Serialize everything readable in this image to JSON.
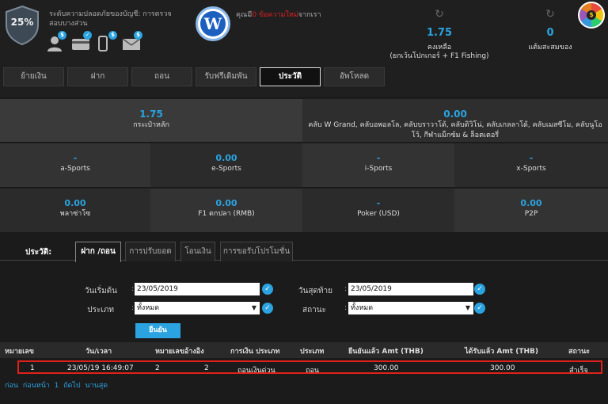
{
  "header": {
    "security_percent": "25%",
    "security_text": "ระดับความปลอดภัยของบัญชี: การตรวจสอบบางส่วน",
    "message_prefix": "คุณมี",
    "message_count": "0",
    "message_highlight": " ข้อความใหม่",
    "message_suffix": "จากเรา",
    "logo_letter": "W",
    "balance_main": {
      "value": "1.75",
      "label_line1": "คงเหลือ",
      "label_line2": "(ยกเว้นโปกเกอร์ + F1 Fishing)"
    },
    "balance_points": {
      "value": "0",
      "label": "แต้มสะสมของ"
    },
    "wheel_symbol": "$",
    "verify_badge": "$"
  },
  "tabs": [
    {
      "label": "ย้ายเงิน",
      "active": false
    },
    {
      "label": "ฝาก",
      "active": false
    },
    {
      "label": "ถอน",
      "active": false
    },
    {
      "label": "รับฟรีเดิมพัน",
      "active": false
    },
    {
      "label": "ประวัติ",
      "active": true
    },
    {
      "label": "อัพโหลด",
      "active": false
    }
  ],
  "wallets": {
    "main": {
      "value": "1.75",
      "label": "กระเป๋าหลัก"
    },
    "clubs": {
      "value": "0.00",
      "label_line1": "คลับ W Grand, คลับอพอลโล, คลับบราวาโด้, คลับดิวิโน่, คลับเกลลาโด้, คลับเมสซีโม, คลับนูโอ",
      "label_line2": "โว้, กีฬาแม็กซ์ม & ล็อตเตอรี่"
    },
    "grid": [
      {
        "value": "-",
        "label": "a-Sports"
      },
      {
        "value": "0.00",
        "label": "e-Sports"
      },
      {
        "value": "-",
        "label": "i-Sports"
      },
      {
        "value": "-",
        "label": "x-Sports"
      },
      {
        "value": "0.00",
        "label": "พลาซ่าโซ"
      },
      {
        "value": "0.00",
        "label": "F1 ตกปลา (RMB)"
      },
      {
        "value": "-",
        "label": "Poker (USD)"
      },
      {
        "value": "0.00",
        "label": "P2P"
      }
    ]
  },
  "history": {
    "label": "ประวัติ:",
    "tabs": [
      "ฝาก /ถอน",
      "การปรับยอด",
      "โอนเงิน",
      "การขอรับโปรโมชั่น"
    ],
    "filters": {
      "start_label": "วันเริ่มต้น",
      "start_value": "23/05/2019",
      "end_label": "วันสุดท้าย",
      "end_value": "23/05/2019",
      "type_label": "ประเภท",
      "type_value": "ทั้งหมด",
      "status_label": "สถานะ",
      "status_value": "ทั้งหมด",
      "colon": ":",
      "check": "✓",
      "caret": "▼"
    },
    "confirm_label": "ยืนยัน",
    "columns": [
      "หมายเลข",
      "วัน/เวลา",
      "หมายเลขอ้างอิง",
      "การเงิน ประเภท",
      "ประเภท",
      "ยืนยันแล้ว Amt (THB)",
      "ได้รับแล้ว Amt (THB)",
      "สถานะ"
    ],
    "row": {
      "no": "1",
      "datetime": "23/05/19 16:49:07",
      "ref_a": "2",
      "ref_b": "2",
      "fin_type": "ถอนเงินด่วน",
      "type": "ถอน",
      "confirmed": "300.00",
      "received": "300.00",
      "status": "สำเร็จ"
    },
    "pager": [
      "ก่อน",
      "ก่อนหน้า",
      "1",
      "ถัดไป",
      "นานสุด"
    ]
  },
  "colors": {
    "accent": "#2aa3e0",
    "highlight_border": "#e0201a",
    "message_red": "#e02020"
  }
}
